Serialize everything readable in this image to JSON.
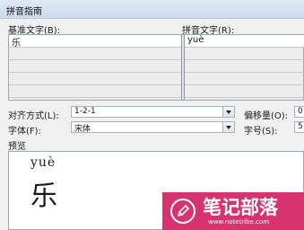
{
  "window": {
    "title": "拼音指南"
  },
  "grid": {
    "base_header": "基准文字(B):",
    "ruby_header": "拼音文字(R):",
    "rows": [
      {
        "base": "乐",
        "ruby": "yuè"
      },
      {
        "base": "",
        "ruby": ""
      },
      {
        "base": "",
        "ruby": ""
      },
      {
        "base": "",
        "ruby": ""
      },
      {
        "base": "",
        "ruby": ""
      }
    ]
  },
  "options": {
    "alignment_label": "对齐方式(L):",
    "alignment_value": "1-2-1",
    "offset_label": "偏移量(O):",
    "offset_value": "0",
    "font_label": "字体(F):",
    "font_value": "宋体",
    "size_label": "字号(S):",
    "size_value": "5"
  },
  "preview": {
    "label": "预览",
    "pinyin": "yuè",
    "character": "乐"
  },
  "watermark": {
    "text": "笔记部落",
    "url": "www.notetribe.com",
    "color": "#d7336f",
    "icon": "pencil-icon"
  }
}
